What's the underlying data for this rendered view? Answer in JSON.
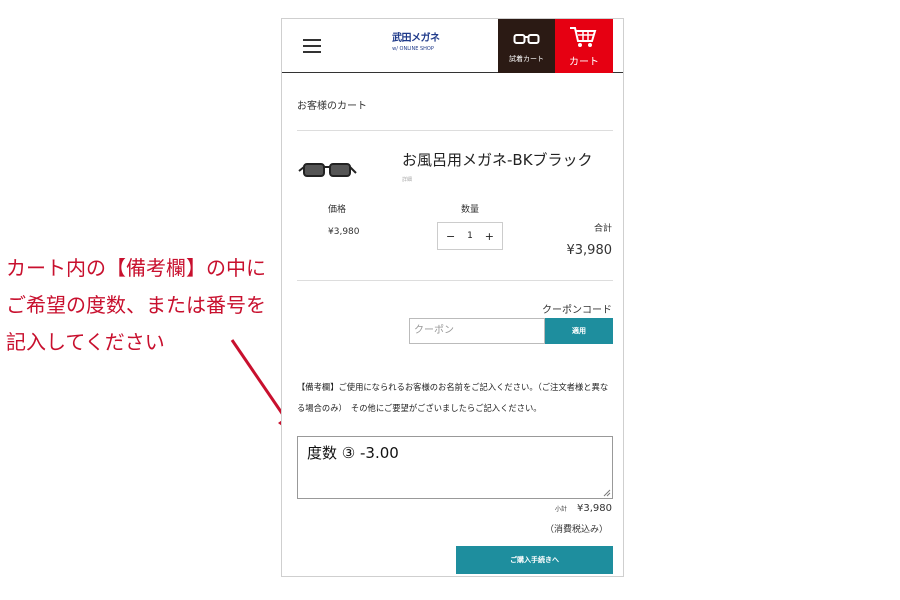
{
  "annotation": {
    "lines": [
      "カート内の【備考欄】の中に",
      "ご希望の度数、または番号を",
      "記入してください"
    ]
  },
  "header": {
    "menu_icon": "hamburger-icon",
    "logo_line1": "武田メガネ",
    "logo_line2": "w/ ONLINE SHOP",
    "trial_icon": "glasses-icon",
    "trial_label": "試着カート",
    "cart_icon": "cart-icon",
    "cart_label": "カート",
    "cart_color": "#e60012",
    "trial_color": "#2b1a14"
  },
  "breadcrumb": "お客様のカート",
  "product": {
    "name": "お風呂用メガネ-BKブラック",
    "note": "詳細",
    "price_label": "価格",
    "price": "¥3,980",
    "qty_label": "数量",
    "qty_minus": "−",
    "qty_value": "1",
    "qty_plus": "+",
    "total_label": "合計",
    "total": "¥3,980"
  },
  "coupon": {
    "label": "クーポンコード",
    "placeholder": "クーポン",
    "button": "適用"
  },
  "remarks": {
    "label": "【備考欄】ご使用になられるお客様のお名前をご記入ください。（ご注文者様と異なる場合のみ）　その他にご要望がございましたらご記入ください。",
    "value": "度数 ③ -3.00"
  },
  "summary": {
    "subtotal_label": "小計",
    "subtotal": "¥3,980",
    "tax_note": "（消費税込み）",
    "checkout_button": "ご購入手続きへ"
  },
  "colors": {
    "accent": "#1e8e9e",
    "annotation": "#c8102e"
  }
}
